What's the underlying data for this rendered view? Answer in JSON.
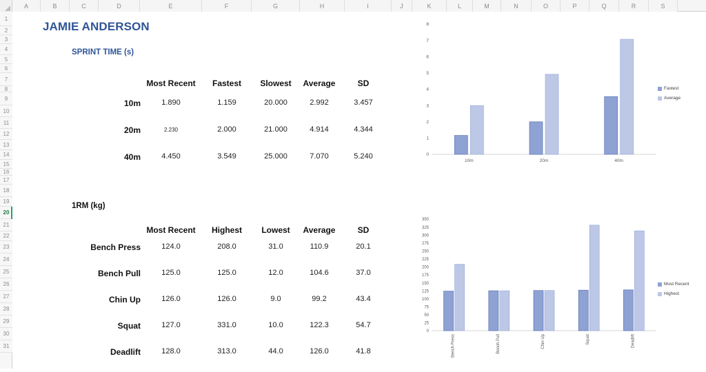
{
  "grid": {
    "columns": [
      "A",
      "B",
      "C",
      "D",
      "E",
      "F",
      "G",
      "H",
      "I",
      "J",
      "K",
      "L",
      "M",
      "N",
      "O",
      "P",
      "Q",
      "R",
      "S"
    ],
    "rows": [
      "1",
      "2",
      "3",
      "4",
      "5",
      "6",
      "7",
      "8",
      "9",
      "10",
      "11",
      "12",
      "13",
      "14",
      "15",
      "16",
      "17",
      "18",
      "19",
      "20",
      "21",
      "22",
      "23",
      "24",
      "25",
      "26",
      "27",
      "28",
      "29",
      "30",
      "31"
    ],
    "active_row": "20"
  },
  "colors": {
    "title_blue": "#2f5597",
    "series_dark": "#8fa2d4",
    "series_dark_stroke": "#5b74b5",
    "series_light": "#bcc8e6",
    "series_light_stroke": "#9aacd9",
    "active_green": "#21a366"
  },
  "page": {
    "title": "JAMIE ANDERSON"
  },
  "sprint": {
    "heading": "SPRINT TIME (s)",
    "headers": [
      "Most Recent",
      "Fastest",
      "Slowest",
      "Average",
      "SD"
    ],
    "rows": [
      {
        "label": "10m",
        "most_recent": "1.890",
        "fastest": "1.159",
        "slowest": "20.000",
        "average": "2.992",
        "sd": "3.457"
      },
      {
        "label": "20m",
        "most_recent": "2.230",
        "fastest": "2.000",
        "slowest": "21.000",
        "average": "4.914",
        "sd": "4.344"
      },
      {
        "label": "40m",
        "most_recent": "4.450",
        "fastest": "3.549",
        "slowest": "25.000",
        "average": "7.070",
        "sd": "5.240"
      }
    ]
  },
  "onerm": {
    "heading": "1RM (kg)",
    "headers": [
      "Most Recent",
      "Highest",
      "Lowest",
      "Average",
      "SD"
    ],
    "rows": [
      {
        "label": "Bench Press",
        "most_recent": "124.0",
        "highest": "208.0",
        "lowest": "31.0",
        "average": "110.9",
        "sd": "20.1"
      },
      {
        "label": "Bench Pull",
        "most_recent": "125.0",
        "highest": "125.0",
        "lowest": "12.0",
        "average": "104.6",
        "sd": "37.0"
      },
      {
        "label": "Chin Up",
        "most_recent": "126.0",
        "highest": "126.0",
        "lowest": "9.0",
        "average": "99.2",
        "sd": "43.4"
      },
      {
        "label": "Squat",
        "most_recent": "127.0",
        "highest": "331.0",
        "lowest": "10.0",
        "average": "122.3",
        "sd": "54.7"
      },
      {
        "label": "Deadlift",
        "most_recent": "128.0",
        "highest": "313.0",
        "lowest": "44.0",
        "average": "126.0",
        "sd": "41.8"
      }
    ]
  },
  "chart_data": [
    {
      "type": "bar",
      "title": "",
      "categories": [
        "10m",
        "20m",
        "40m"
      ],
      "series": [
        {
          "name": "Fastest",
          "values": [
            1.159,
            2.0,
            3.549
          ],
          "color": "#8fa2d4"
        },
        {
          "name": "Average",
          "values": [
            2.992,
            4.914,
            7.07
          ],
          "color": "#bcc8e6"
        }
      ],
      "xlabel": "",
      "ylabel": "",
      "ylim": [
        0,
        8
      ],
      "yticks": [
        0,
        1,
        2,
        3,
        4,
        5,
        6,
        7,
        8
      ],
      "grid": false,
      "legend_position": "right"
    },
    {
      "type": "bar",
      "title": "",
      "categories": [
        "Bench Press",
        "Bench Pull",
        "Chin Up",
        "Squat",
        "Deadlift"
      ],
      "series": [
        {
          "name": "Most Recent",
          "values": [
            124.0,
            125.0,
            126.0,
            127.0,
            128.0
          ],
          "color": "#8fa2d4"
        },
        {
          "name": "Highest",
          "values": [
            208.0,
            125.0,
            126.0,
            331.0,
            313.0
          ],
          "color": "#bcc8e6"
        }
      ],
      "xlabel": "",
      "ylabel": "",
      "ylim": [
        0,
        350
      ],
      "yticks": [
        0,
        25,
        50,
        75,
        100,
        125,
        150,
        175,
        200,
        225,
        250,
        275,
        300,
        325,
        350
      ],
      "grid": false,
      "legend_position": "right"
    }
  ]
}
